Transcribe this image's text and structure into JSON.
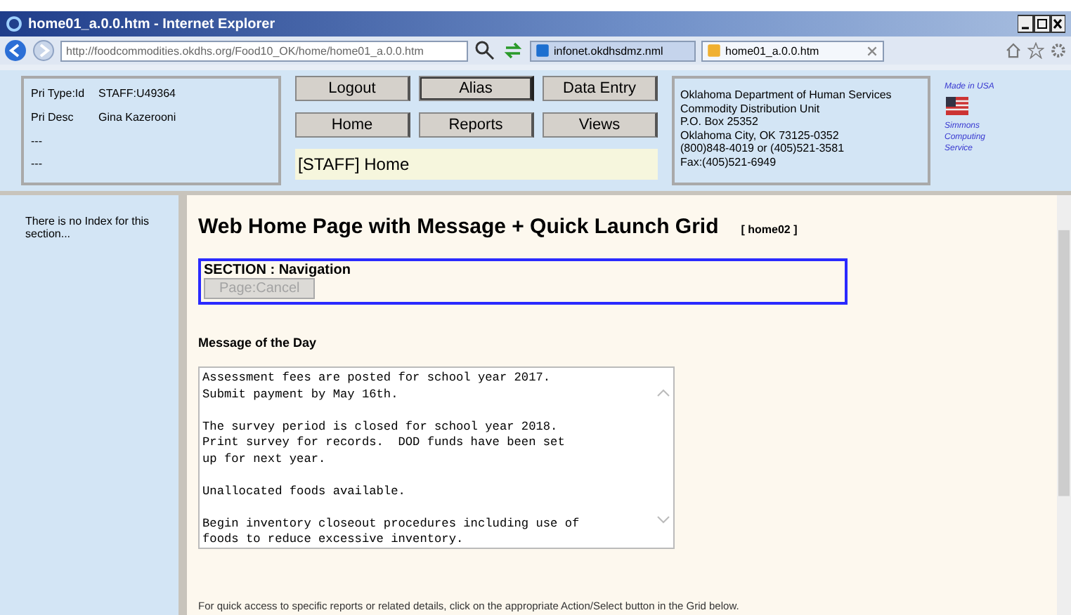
{
  "window": {
    "title": "home01_a.0.0.htm - Internet Explorer"
  },
  "address_bar": {
    "url": "http://foodcommodities.okdhs.org/Food10_OK/home/home01_a.0.0.htm"
  },
  "tabs": [
    {
      "label": "infonet.okdhsdmz.nml",
      "selected": false
    },
    {
      "label": "home01_a.0.0.htm",
      "selected": true
    }
  ],
  "user_info": [
    {
      "label": "Pri Type:Id",
      "value": "STAFF:U49364"
    },
    {
      "label": "Pri Desc",
      "value": "Gina Kazerooni"
    },
    {
      "label": "---"
    },
    {
      "label": "---"
    }
  ],
  "nav_buttons": [
    {
      "label": "Logout",
      "selected": false
    },
    {
      "label": "Alias",
      "selected": true
    },
    {
      "label": "Data Entry",
      "selected": false
    },
    {
      "label": "Home",
      "selected": false
    },
    {
      "label": "Reports",
      "selected": false
    },
    {
      "label": "Views",
      "selected": false
    }
  ],
  "page_label": "[STAFF] Home",
  "address_lines": [
    "Oklahoma Department of Human Services",
    "Commodity Distribution Unit",
    "P.O. Box 25352",
    "Oklahoma City, OK 73125-0352",
    "(800)848-4019 or (405)521-3581",
    "Fax:(405)521-6949"
  ],
  "badge": {
    "made_in": "Made in USA",
    "vendor": "Simmons Computing Service"
  },
  "sidebar": {
    "note": "There is no Index for this section..."
  },
  "main": {
    "title": "Web Home Page with Message + Quick Launch Grid",
    "page_code": "[ home02 ]",
    "section": {
      "title": "SECTION : Navigation",
      "button": {
        "label": "Page:Cancel",
        "disabled": true
      }
    },
    "motd_heading": "Message of the Day",
    "motd_text": "Assessment fees are posted for school year 2017.\nSubmit payment by May 16th.\n\nThe survey period is closed for school year 2018.\nPrint survey for records.  DOD funds have been set\nup for next year.\n\nUnallocated foods available.\n\nBegin inventory closeout procedures including use of\nfoods to reduce excessive inventory.",
    "footer_text": "For quick access to specific reports or related details, click on the appropriate Action/Select button in the Grid below."
  }
}
